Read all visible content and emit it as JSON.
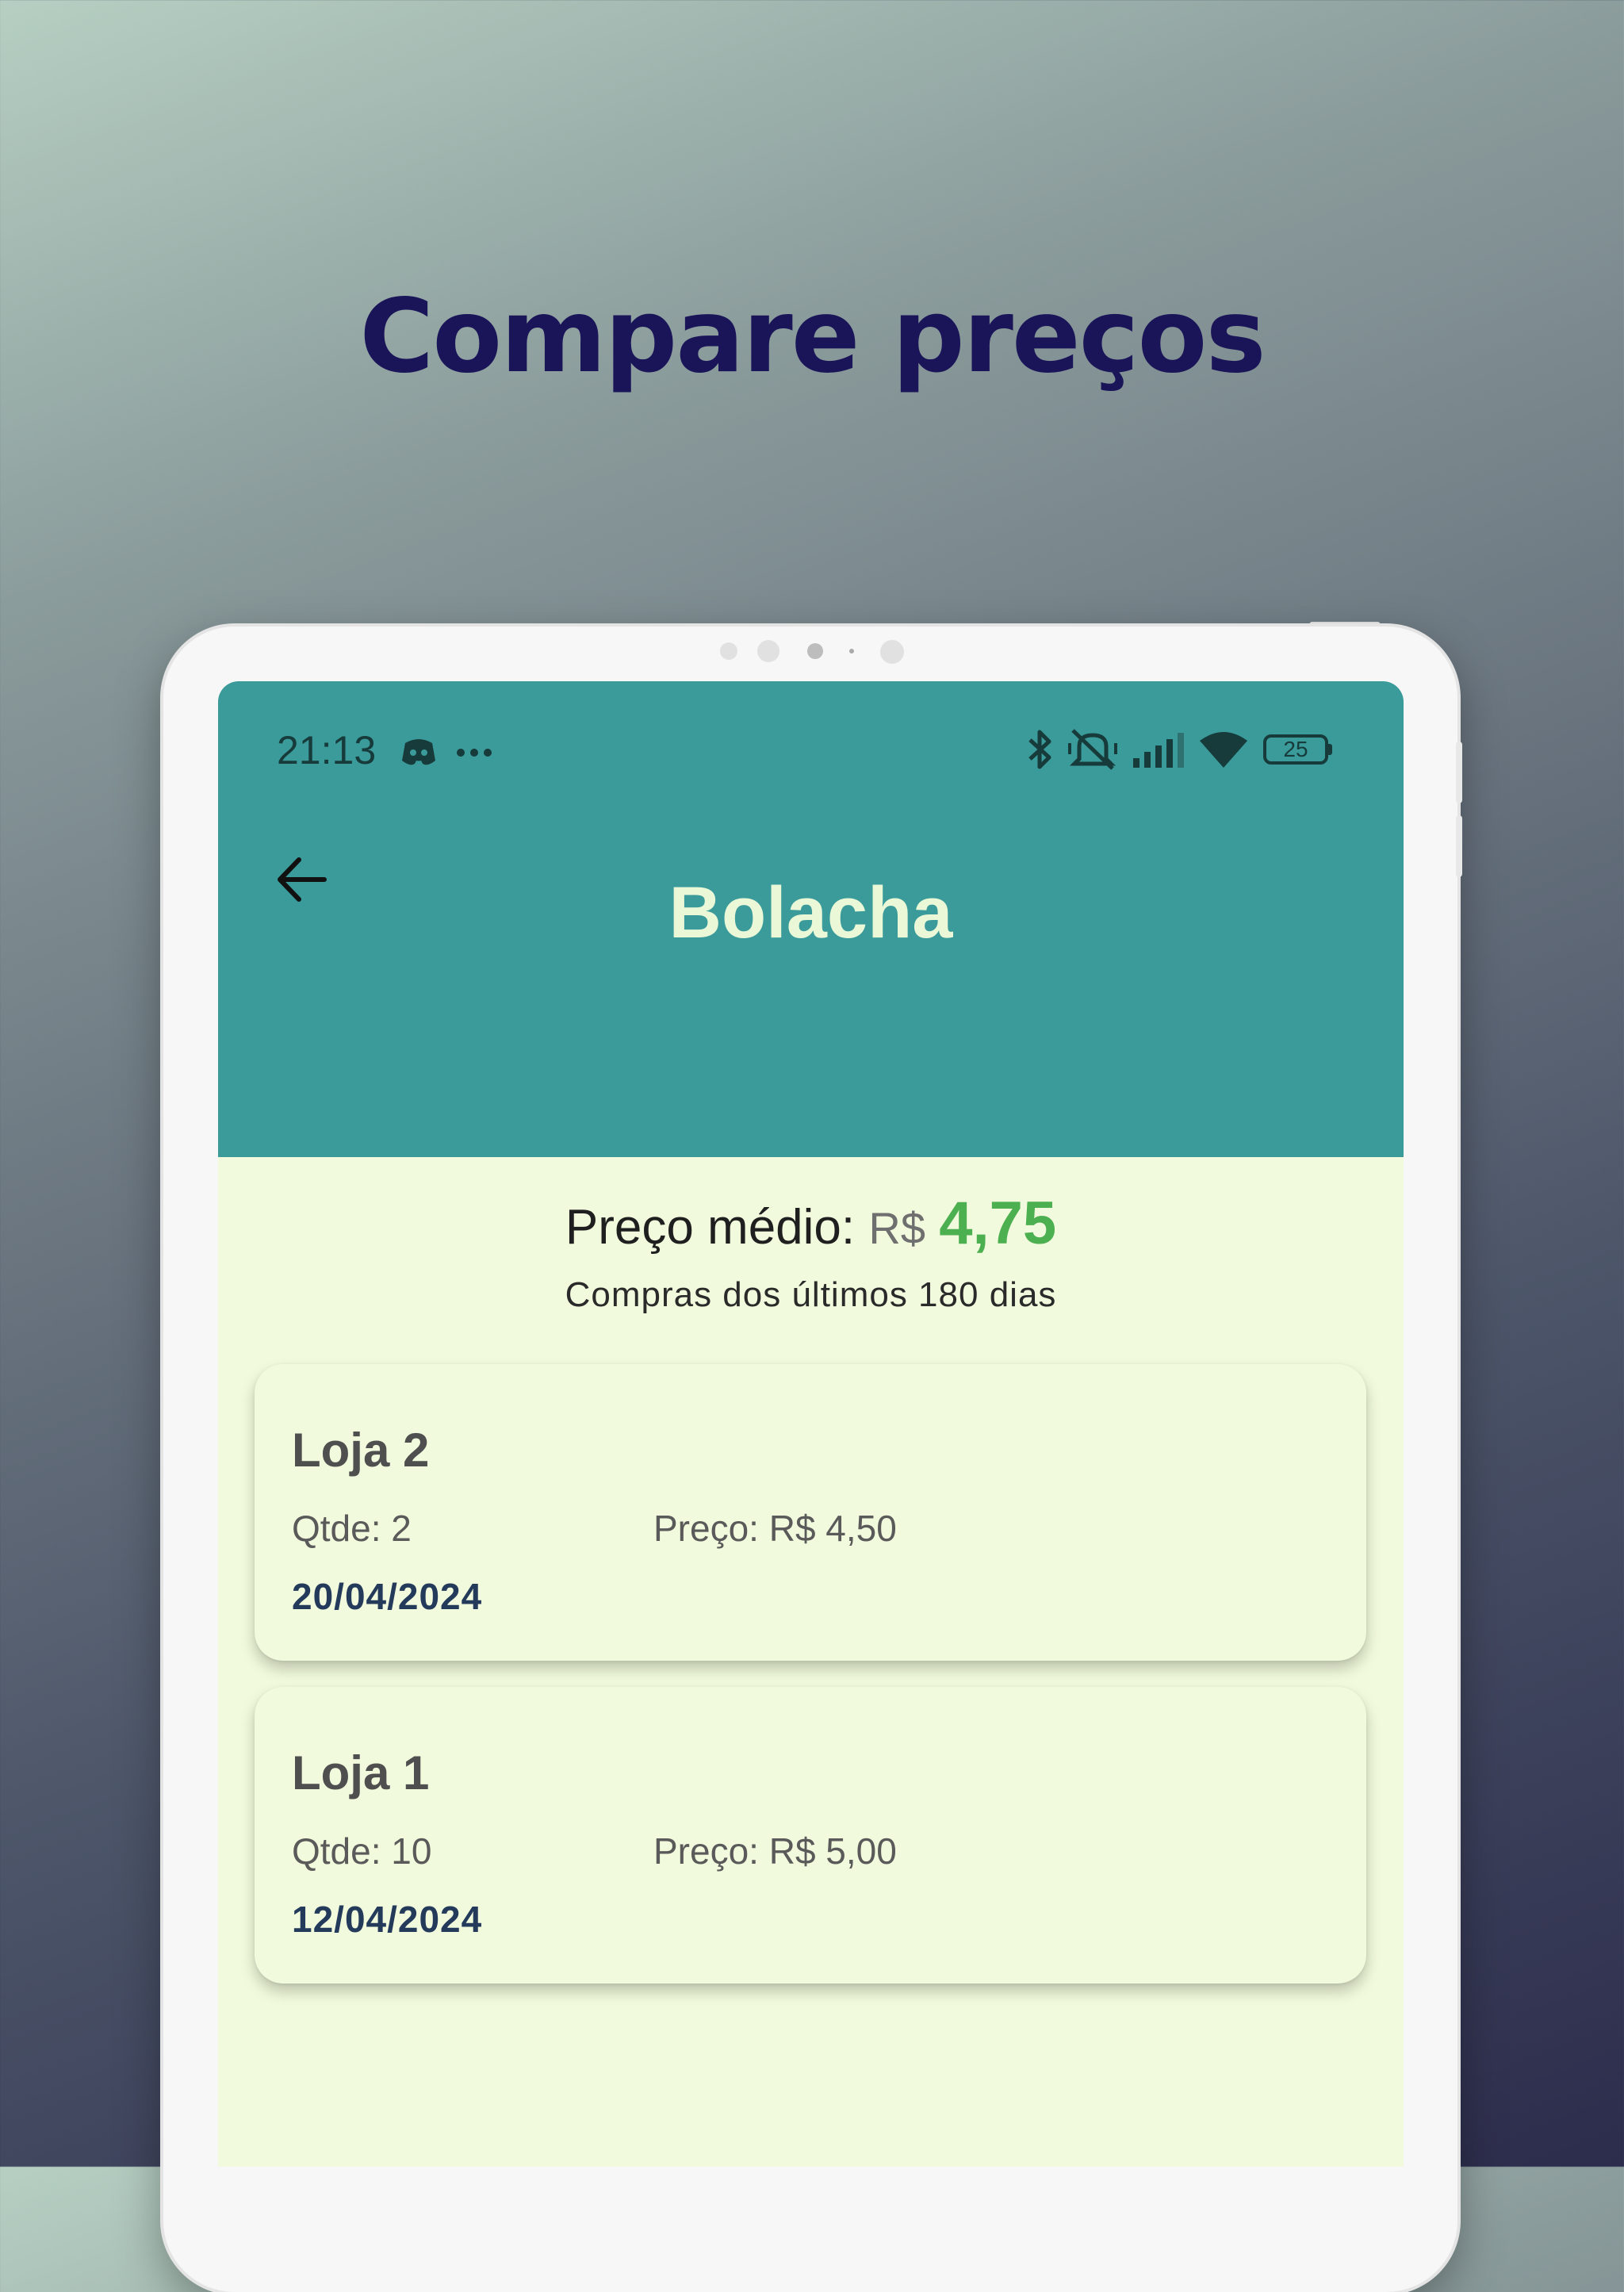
{
  "headline": "Compare preços",
  "status_bar": {
    "time": "21:13",
    "battery": "25",
    "icons": [
      "discord-icon",
      "more-icon",
      "bluetooth-icon",
      "mute-icon",
      "signal-icon",
      "wifi-icon",
      "battery-icon"
    ]
  },
  "app_bar": {
    "title": "Bolacha",
    "back_icon": "arrow-left-icon"
  },
  "summary": {
    "avg_label": "Preço médio:",
    "currency": "R$",
    "avg_value": "4,75",
    "period": "Compras dos últimos 180 dias"
  },
  "purchases": [
    {
      "store": "Loja 2",
      "qty": "Qtde: 2",
      "price": "Preço: R$ 4,50",
      "date": "20/04/2024"
    },
    {
      "store": "Loja 1",
      "qty": "Qtde: 10",
      "price": "Preço: R$ 5,00",
      "date": "12/04/2024"
    }
  ],
  "colors": {
    "app_bar": "#3a9b9a",
    "background": "#f1fadc",
    "avg_value": "#4caf50",
    "headline": "#1a1458"
  }
}
